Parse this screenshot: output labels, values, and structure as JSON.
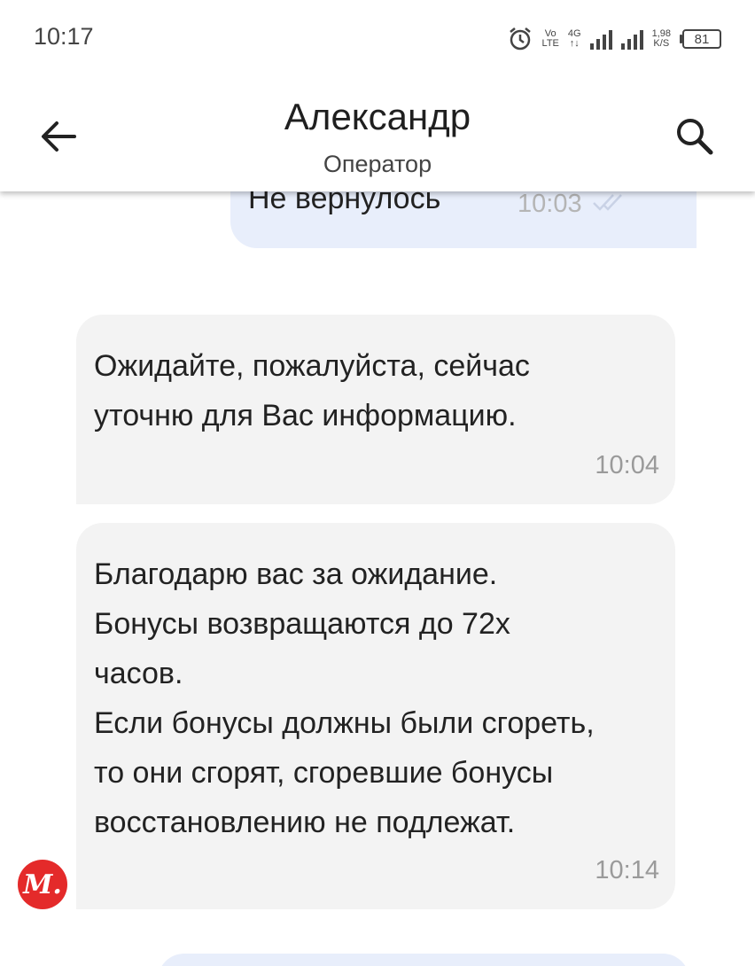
{
  "status_bar": {
    "time": "10:17",
    "network_1_top": "Vo",
    "network_1_bottom": "LTE",
    "network_2_top": "4G",
    "network_2_bottom": "↑↓",
    "speed_value": "1,98",
    "speed_unit": "K/S",
    "battery": "81",
    "icons": [
      "alarm-icon",
      "signal-icon",
      "signal-icon",
      "battery-icon"
    ]
  },
  "header": {
    "title": "Александр",
    "subtitle": "Оператор",
    "icons": [
      "back-arrow-icon",
      "search-icon"
    ]
  },
  "messages": [
    {
      "direction": "outgoing",
      "text": "Не вернулось",
      "time": "10:03",
      "status_icon": "double-check-icon"
    },
    {
      "direction": "incoming",
      "text": "Ожидайте, пожалуйста, сейчас\nуточню для Вас информацию.",
      "time": "10:04"
    },
    {
      "direction": "incoming",
      "text": "Благодарю вас за ожидание.\nБонусы возвращаются до 72х\nчасов.\nЕсли бонусы должны были сгореть,\nто они сгорят, сгоревшие бонусы\nвосстановлению не подлежат.",
      "time": "10:14"
    }
  ],
  "avatar": {
    "text": "М.",
    "color": "#e42a2a"
  },
  "colors": {
    "outgoing_bubble": "#e8eefb",
    "incoming_bubble": "#f3f3f3"
  }
}
